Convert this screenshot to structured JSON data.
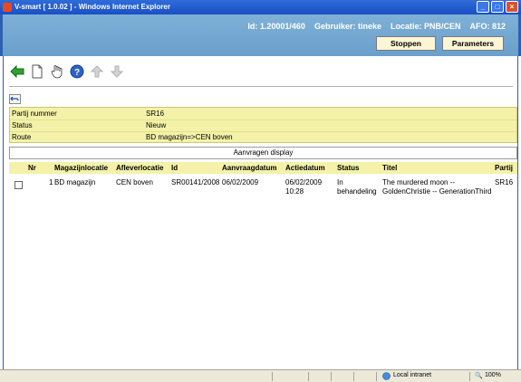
{
  "window": {
    "title": "V-smart [ 1.0.02 ] - Windows Internet Explorer"
  },
  "header": {
    "id_text": "Id: 1.20001/460",
    "user_text": "Gebruiker: tineke",
    "location_text": "Locatie: PNB/CEN",
    "afo_text": "AFO: 812",
    "stop_label": "Stoppen",
    "params_label": "Parameters"
  },
  "toolbar": {
    "icons": [
      "back-arrow-icon",
      "new-document-icon",
      "hand-select-icon",
      "help-icon",
      "up-arrow-icon",
      "down-arrow-icon"
    ]
  },
  "details": {
    "rows": [
      {
        "key": "Partij nummer",
        "value": "SR16"
      },
      {
        "key": "Status",
        "value": "Nieuw"
      },
      {
        "key": "Route",
        "value": "BD magazijn=>CEN boven"
      }
    ]
  },
  "panel": {
    "title": "Aanvragen display"
  },
  "table": {
    "headers": [
      "Nr",
      "Magazijnlocatie",
      "Afleverlocatie",
      "Id",
      "Aanvraagdatum",
      "Actiedatum",
      "Status",
      "Titel",
      "Partij"
    ],
    "rows": [
      {
        "nr": "1",
        "magazijn": "BD magazijn",
        "aflever": "CEN boven",
        "id": "SR00141/2008",
        "aanvraag": "06/02/2009",
        "actie1": "06/02/2009",
        "actie2": "10:28",
        "status1": "In",
        "status2": "behandeling",
        "titel1": "The murdered moon --",
        "titel2": "GoldenChristie -- GenerationThird",
        "partij": "SR16"
      }
    ]
  },
  "statusbar": {
    "zone": "Local intranet",
    "zoom": "100%"
  },
  "colors": {
    "header_bg": "#7fb0d6",
    "panel_yellow": "#f3f2a8",
    "button_bg": "#fdf6d6"
  }
}
